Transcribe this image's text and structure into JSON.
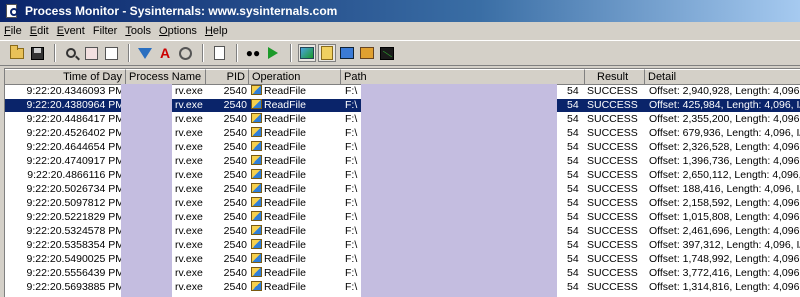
{
  "window": {
    "title": "Process Monitor - Sysinternals: www.sysinternals.com"
  },
  "menu": [
    {
      "accel": "F",
      "rest": "ile"
    },
    {
      "accel": "E",
      "rest": "dit"
    },
    {
      "accel": "E",
      "rest": "vent",
      "accel_index": 0
    },
    {
      "accel": "F",
      "rest": "ilter"
    },
    {
      "accel": "T",
      "rest": "ools"
    },
    {
      "accel": "O",
      "rest": "ptions"
    },
    {
      "accel": "H",
      "rest": "elp"
    }
  ],
  "menu_labels": [
    "File",
    "Edit",
    "Event",
    "Filter",
    "Tools",
    "Options",
    "Help"
  ],
  "toolbar": {
    "icons": [
      "open-icon",
      "save-icon",
      "capture-icon",
      "autoscroll-icon",
      "clear-icon",
      "filter-icon",
      "highlight-icon",
      "target-icon",
      "process-tree-icon",
      "find-icon",
      "jump-icon",
      "registry-activity-icon",
      "file-activity-icon",
      "network-activity-icon",
      "process-activity-icon",
      "profiling-activity-icon"
    ]
  },
  "columns": [
    "Time of Day",
    "Process Name",
    "PID",
    "Operation",
    "Path",
    "Result",
    "Detail"
  ],
  "rows": [
    {
      "time": "9:22:20.4346093 PM",
      "proc": "rv.exe",
      "pid": "2540",
      "op": "ReadFile",
      "path": "F:\\",
      "tail": "54",
      "result": "SUCCESS",
      "detail": "Offset: 2,940,928, Length: 4,096, I"
    },
    {
      "time": "9:22:20.4380964 PM",
      "proc": "rv.exe",
      "pid": "2540",
      "op": "ReadFile",
      "path": "F:\\",
      "tail": "54",
      "result": "SUCCESS",
      "detail": "Offset: 425,984, Length: 4,096, I/O"
    },
    {
      "time": "9:22:20.4486417 PM",
      "proc": "rv.exe",
      "pid": "2540",
      "op": "ReadFile",
      "path": "F:\\",
      "tail": "54",
      "result": "SUCCESS",
      "detail": "Offset: 2,355,200, Length: 4,096, I"
    },
    {
      "time": "9:22:20.4526402 PM",
      "proc": "rv.exe",
      "pid": "2540",
      "op": "ReadFile",
      "path": "F:\\",
      "tail": "54",
      "result": "SUCCESS",
      "detail": "Offset: 679,936, Length: 4,096, I/O"
    },
    {
      "time": "9:22:20.4644654 PM",
      "proc": "rv.exe",
      "pid": "2540",
      "op": "ReadFile",
      "path": "F:\\",
      "tail": "54",
      "result": "SUCCESS",
      "detail": "Offset: 2,326,528, Length: 4,096, I"
    },
    {
      "time": "9:22:20.4740917 PM",
      "proc": "rv.exe",
      "pid": "2540",
      "op": "ReadFile",
      "path": "F:\\",
      "tail": "54",
      "result": "SUCCESS",
      "detail": "Offset: 1,396,736, Length: 4,096, I"
    },
    {
      "time": "9:22:20.4866116 PM",
      "proc": "rv.exe",
      "pid": "2540",
      "op": "ReadFile",
      "path": "F:\\",
      "tail": "54",
      "result": "SUCCESS",
      "detail": "Offset: 2,650,112, Length: 4,096, I"
    },
    {
      "time": "9:22:20.5026734 PM",
      "proc": "rv.exe",
      "pid": "2540",
      "op": "ReadFile",
      "path": "F:\\",
      "tail": "54",
      "result": "SUCCESS",
      "detail": "Offset: 188,416, Length: 4,096, I/O"
    },
    {
      "time": "9:22:20.5097812 PM",
      "proc": "rv.exe",
      "pid": "2540",
      "op": "ReadFile",
      "path": "F:\\",
      "tail": "54",
      "result": "SUCCESS",
      "detail": "Offset: 2,158,592, Length: 4,096, I"
    },
    {
      "time": "9:22:20.5221829 PM",
      "proc": "rv.exe",
      "pid": "2540",
      "op": "ReadFile",
      "path": "F:\\",
      "tail": "54",
      "result": "SUCCESS",
      "detail": "Offset: 1,015,808, Length: 4,096, I"
    },
    {
      "time": "9:22:20.5324578 PM",
      "proc": "rv.exe",
      "pid": "2540",
      "op": "ReadFile",
      "path": "F:\\",
      "tail": "54",
      "result": "SUCCESS",
      "detail": "Offset: 2,461,696, Length: 4,096, I"
    },
    {
      "time": "9:22:20.5358354 PM",
      "proc": "rv.exe",
      "pid": "2540",
      "op": "ReadFile",
      "path": "F:\\",
      "tail": "54",
      "result": "SUCCESS",
      "detail": "Offset: 397,312, Length: 4,096, I/O"
    },
    {
      "time": "9:22:20.5490025 PM",
      "proc": "rv.exe",
      "pid": "2540",
      "op": "ReadFile",
      "path": "F:\\",
      "tail": "54",
      "result": "SUCCESS",
      "detail": "Offset: 1,748,992, Length: 4,096, I"
    },
    {
      "time": "9:22:20.5556439 PM",
      "proc": "rv.exe",
      "pid": "2540",
      "op": "ReadFile",
      "path": "F:\\",
      "tail": "54",
      "result": "SUCCESS",
      "detail": "Offset: 3,772,416, Length: 4,096, I"
    },
    {
      "time": "9:22:20.5693885 PM",
      "proc": "rv.exe",
      "pid": "2540",
      "op": "ReadFile",
      "path": "F:\\",
      "tail": "54",
      "result": "SUCCESS",
      "detail": "Offset: 1,314,816, Length: 4,096, I"
    }
  ],
  "selected_row": 1,
  "colors": {
    "selection": "#0a246a",
    "redaction": "#c4bde0",
    "title_bar": "#0a246a"
  }
}
